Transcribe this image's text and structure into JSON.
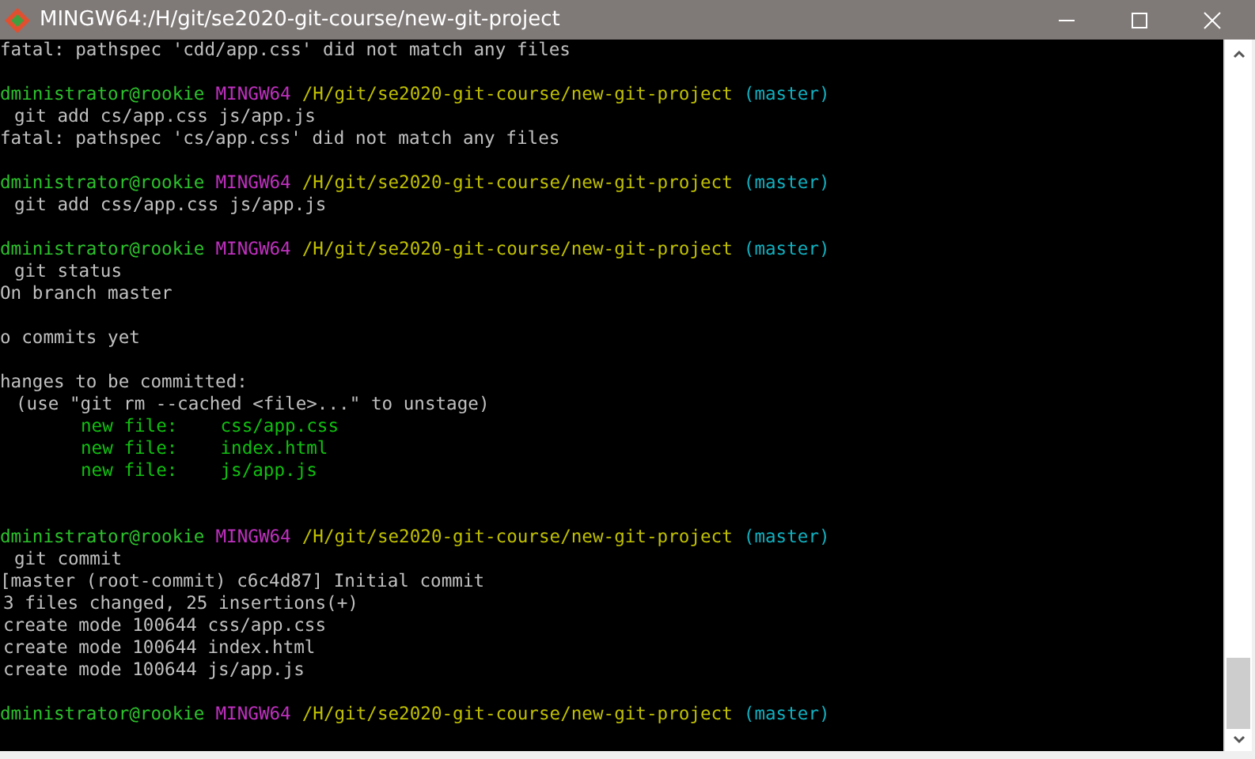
{
  "window": {
    "title": "MINGW64:/H/git/se2020-git-course/new-git-project"
  },
  "terminal": {
    "lines": [
      {
        "kind": "text",
        "text": "fatal: pathspec 'cdd/app.css' did not match any files"
      },
      {
        "kind": "blank"
      },
      {
        "kind": "prompt",
        "user": "dministrator@rookie",
        "host": "MINGW64",
        "path": "/H/git/se2020-git-course/new-git-project",
        "branch": "(master)"
      },
      {
        "kind": "command",
        "text": "git add cs/app.css js/app.js"
      },
      {
        "kind": "text",
        "text": "fatal: pathspec 'cs/app.css' did not match any files"
      },
      {
        "kind": "blank"
      },
      {
        "kind": "prompt",
        "user": "dministrator@rookie",
        "host": "MINGW64",
        "path": "/H/git/se2020-git-course/new-git-project",
        "branch": "(master)"
      },
      {
        "kind": "command",
        "text": "git add css/app.css js/app.js"
      },
      {
        "kind": "blank"
      },
      {
        "kind": "prompt",
        "user": "dministrator@rookie",
        "host": "MINGW64",
        "path": "/H/git/se2020-git-course/new-git-project",
        "branch": "(master)"
      },
      {
        "kind": "command",
        "text": "git status"
      },
      {
        "kind": "text",
        "text": "On branch master"
      },
      {
        "kind": "blank"
      },
      {
        "kind": "text",
        "text": "o commits yet"
      },
      {
        "kind": "blank"
      },
      {
        "kind": "text",
        "text": "hanges to be committed:"
      },
      {
        "kind": "hint",
        "text": "(use \"git rm --cached <file>...\" to unstage)"
      },
      {
        "kind": "staged",
        "label": "new file:",
        "file": "css/app.css"
      },
      {
        "kind": "staged",
        "label": "new file:",
        "file": "index.html"
      },
      {
        "kind": "staged",
        "label": "new file:",
        "file": "js/app.js"
      },
      {
        "kind": "blank"
      },
      {
        "kind": "blank"
      },
      {
        "kind": "prompt",
        "user": "dministrator@rookie",
        "host": "MINGW64",
        "path": "/H/git/se2020-git-course/new-git-project",
        "branch": "(master)"
      },
      {
        "kind": "command",
        "text": "git commit"
      },
      {
        "kind": "text",
        "text": "[master (root-commit) c6c4d87] Initial commit"
      },
      {
        "kind": "detail",
        "text": "3 files changed, 25 insertions(+)"
      },
      {
        "kind": "detail",
        "text": "create mode 100644 css/app.css"
      },
      {
        "kind": "detail",
        "text": "create mode 100644 index.html"
      },
      {
        "kind": "detail",
        "text": "create mode 100644 js/app.js"
      },
      {
        "kind": "blank"
      },
      {
        "kind": "prompt",
        "user": "dministrator@rookie",
        "host": "MINGW64",
        "path": "/H/git/se2020-git-course/new-git-project",
        "branch": "(master)"
      },
      {
        "kind": "blank"
      }
    ]
  }
}
